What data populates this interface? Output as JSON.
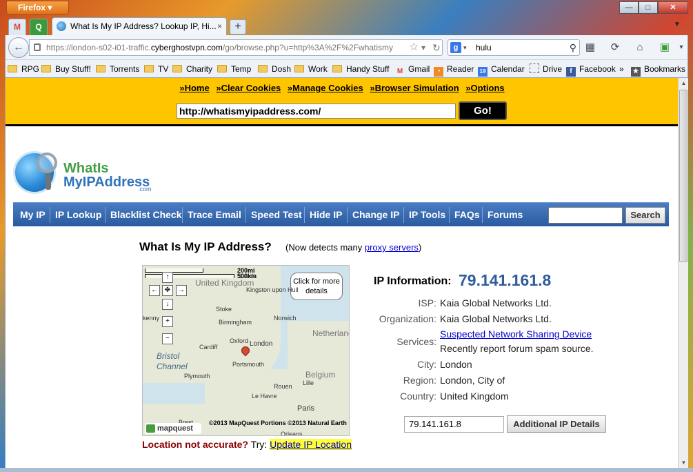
{
  "browser": {
    "menu_button": "Firefox",
    "pinned_tabs": [
      "M",
      "Q"
    ],
    "active_tab_title": "What Is My IP Address? Lookup IP, Hi...",
    "tab_close": "×",
    "new_tab": "+",
    "url_prefix": "https://london-s02-i01-traffic.",
    "url_domain": "cyberghostvpn.com",
    "url_suffix": "/go/browse.php?u=http%3A%2F%2Fwhatismy",
    "search_engine_letter": "g",
    "search_value": "hulu",
    "window_controls": {
      "minimize": "—",
      "maximize": "□",
      "close": "✕"
    }
  },
  "bookmarks": [
    {
      "label": "RPG",
      "icon": "folder-icon"
    },
    {
      "label": "Buy Stuff!",
      "icon": "folder-icon"
    },
    {
      "label": "Torrents",
      "icon": "folder-icon"
    },
    {
      "label": "TV",
      "icon": "folder-icon"
    },
    {
      "label": "Charity",
      "icon": "folder-icon"
    },
    {
      "label": "Temp",
      "icon": "folder-icon"
    },
    {
      "label": "Dosh",
      "icon": "folder-icon"
    },
    {
      "label": "Work",
      "icon": "folder-icon"
    },
    {
      "label": "Handy Stuff",
      "icon": "folder-icon"
    },
    {
      "label": "Gmail",
      "icon": "gmail-icon"
    },
    {
      "label": "Reader",
      "icon": "rss-icon"
    },
    {
      "label": "Calendar",
      "icon": "calendar-icon"
    },
    {
      "label": "Drive",
      "icon": "drive-icon"
    },
    {
      "label": "Facebook",
      "icon": "facebook-icon"
    },
    {
      "label": "»",
      "icon": "chevron-icon"
    },
    {
      "label": "Bookmarks",
      "icon": "bookmarks-icon"
    }
  ],
  "proxy": {
    "links": [
      "»Home",
      "»Clear Cookies",
      "»Manage Cookies",
      "»Browser Simulation",
      "»Options"
    ],
    "url_value": "http://whatismyipaddress.com/",
    "go_label": "Go!"
  },
  "site": {
    "logo_line1": "WhatIs",
    "logo_line2": "MyIPAddress",
    "logo_com": ".com",
    "nav": [
      "My IP",
      "IP Lookup",
      "Blacklist Check",
      "Trace Email",
      "Speed Test",
      "Hide IP",
      "Change IP",
      "IP Tools",
      "FAQs",
      "Forums"
    ],
    "search_label": "Search",
    "heading": "What Is My IP Address?",
    "heading_sub_prefix": "(Now detects many ",
    "heading_sub_link": "proxy servers",
    "heading_sub_suffix": ")"
  },
  "map": {
    "scale_mi": "200mi",
    "scale_km": "500km",
    "callout": "Click for more details",
    "controls": {
      "up": "↑",
      "left": "←",
      "center": "✥",
      "right": "→",
      "down": "↓",
      "zoom_in": "+",
      "zoom_out": "−"
    },
    "countries": [
      "United Kingdom",
      "Netherlands",
      "Belgium"
    ],
    "water": [
      "Bristol Channel"
    ],
    "cities": [
      "Leeds",
      "Kingston upon Hull",
      "Stoke",
      "Birmingham",
      "Norwich",
      "Cardiff",
      "Oxford",
      "London",
      "Portsmouth",
      "Plymouth",
      "Le Havre",
      "Paris",
      "Brest",
      "Orleans",
      "Lille",
      "Rouen",
      "kenny"
    ],
    "copyright": "©2013 MapQuest  Portions ©2013 Natural Earth",
    "logo": "mapquest"
  },
  "location": {
    "question": "Location not accurate?",
    "try": " Try: ",
    "link": "Update IP Location"
  },
  "ip_info": {
    "label": "IP Information:",
    "ip": "79.141.161.8",
    "rows": [
      {
        "label": "ISP:",
        "value": "Kaia Global Networks Ltd."
      },
      {
        "label": "Organization:",
        "value": "Kaia Global Networks Ltd."
      },
      {
        "label": "Services:",
        "value_link": "Suspected Network Sharing Device",
        "value2": "Recently report forum spam source."
      },
      {
        "label": "City:",
        "value": "London"
      },
      {
        "label": "Region:",
        "value": "London, City of"
      },
      {
        "label": "Country:",
        "value": "United Kingdom"
      }
    ],
    "lookup_value": "79.141.161.8",
    "details_button": "Additional IP Details"
  }
}
